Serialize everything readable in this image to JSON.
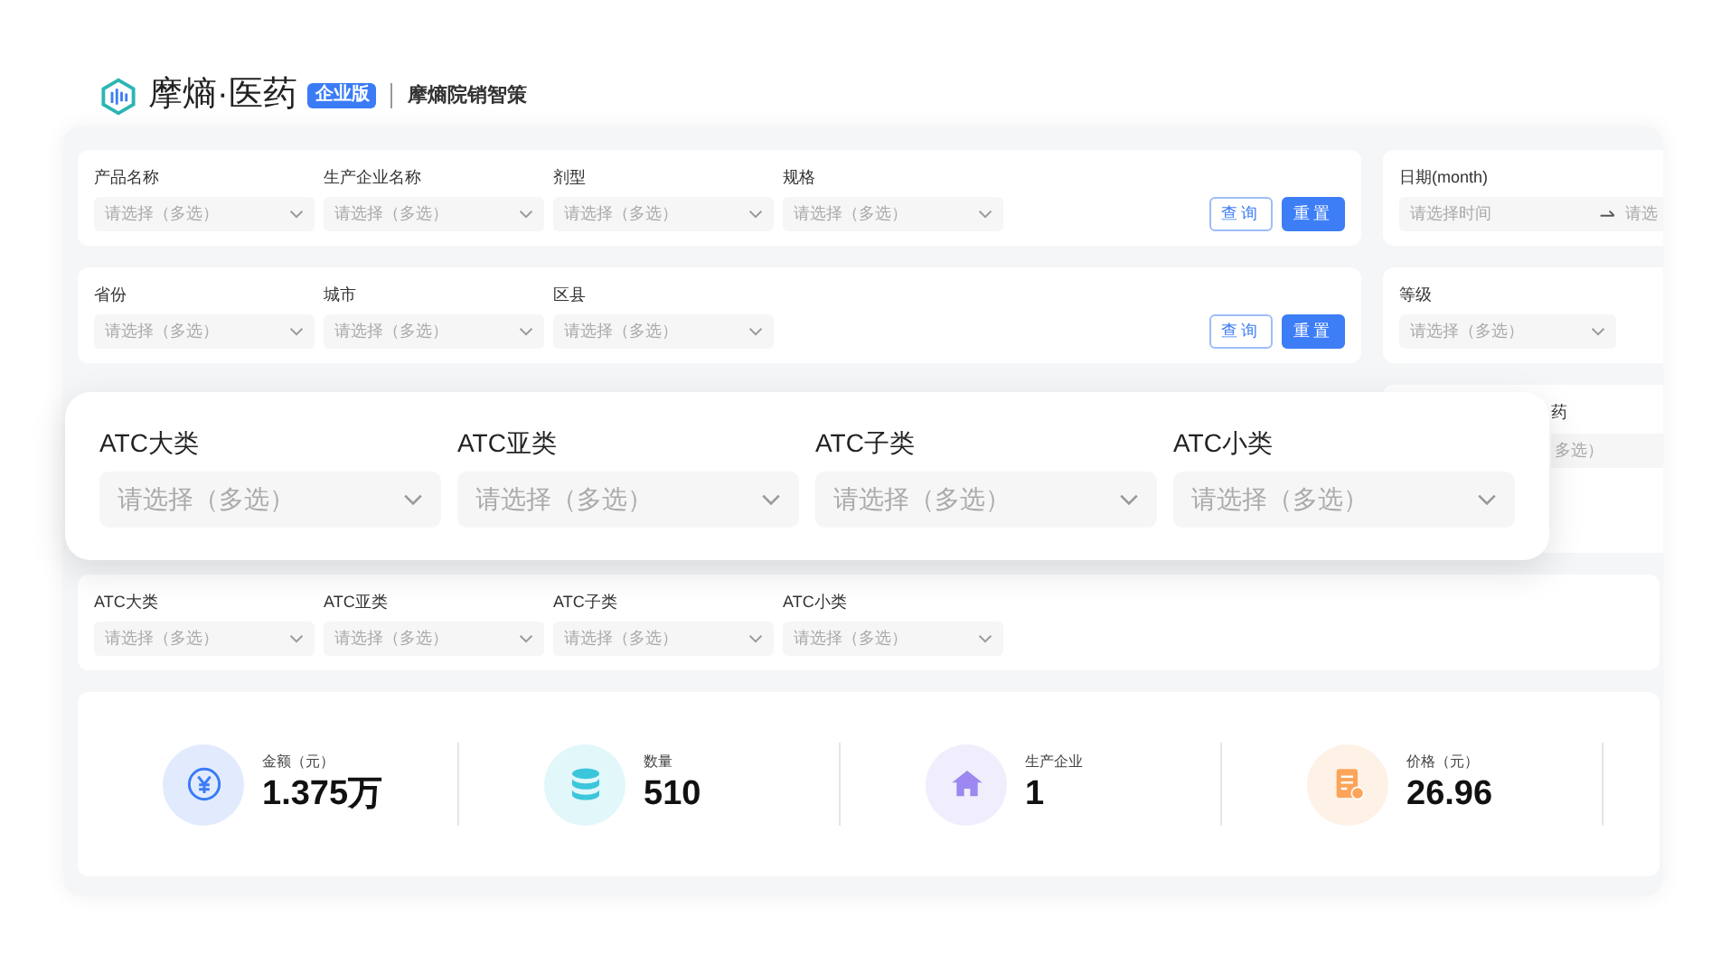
{
  "header": {
    "brand": "摩熵·医药",
    "badge": "企业版",
    "product": "摩熵院销智策"
  },
  "filter_rows": [
    {
      "fields": [
        {
          "label": "产品名称",
          "placeholder": "请选择（多选）"
        },
        {
          "label": "生产企业名称",
          "placeholder": "请选择（多选）"
        },
        {
          "label": "剂型",
          "placeholder": "请选择（多选）"
        },
        {
          "label": "规格",
          "placeholder": "请选择（多选）"
        }
      ],
      "buttons": [
        {
          "label": "查询",
          "kind": "outline"
        },
        {
          "label": "重置",
          "kind": "primary"
        }
      ],
      "side": {
        "kind": "date",
        "label": "日期(month)",
        "start_placeholder": "请选择时间",
        "end_placeholder": "请选"
      }
    },
    {
      "fields": [
        {
          "label": "省份",
          "placeholder": "请选择（多选）"
        },
        {
          "label": "城市",
          "placeholder": "请选择（多选）"
        },
        {
          "label": "区县",
          "placeholder": "请选择（多选）"
        }
      ],
      "buttons": [
        {
          "label": "查询",
          "kind": "outline"
        },
        {
          "label": "重置",
          "kind": "primary"
        }
      ],
      "side": {
        "kind": "select",
        "label": "等级",
        "placeholder": "请选择（多选）"
      }
    }
  ],
  "hidden_row_side": {
    "label": "药",
    "placeholder": "多选）"
  },
  "atc_fields": [
    {
      "label": "ATC大类",
      "placeholder": "请选择（多选）"
    },
    {
      "label": "ATC亚类",
      "placeholder": "请选择（多选）"
    },
    {
      "label": "ATC子类",
      "placeholder": "请选择（多选）"
    },
    {
      "label": "ATC小类",
      "placeholder": "请选择（多选）"
    }
  ],
  "zoom_fields": [
    {
      "label": "ATC大类",
      "placeholder": "请选择（多选）"
    },
    {
      "label": "ATC亚类",
      "placeholder": "请选择（多选）"
    },
    {
      "label": "ATC子类",
      "placeholder": "请选择（多选）"
    },
    {
      "label": "ATC小类",
      "placeholder": "请选择（多选）"
    }
  ],
  "stats": [
    {
      "label": "金额（元）",
      "value": "1.375万",
      "color": "#3b7cf6"
    },
    {
      "label": "数量",
      "value": "510",
      "color": "#3cc6db"
    },
    {
      "label": "生产企业",
      "value": "1",
      "color": "#9c88f0"
    },
    {
      "label": "价格（元）",
      "value": "26.96",
      "color": "#fba45a"
    }
  ]
}
